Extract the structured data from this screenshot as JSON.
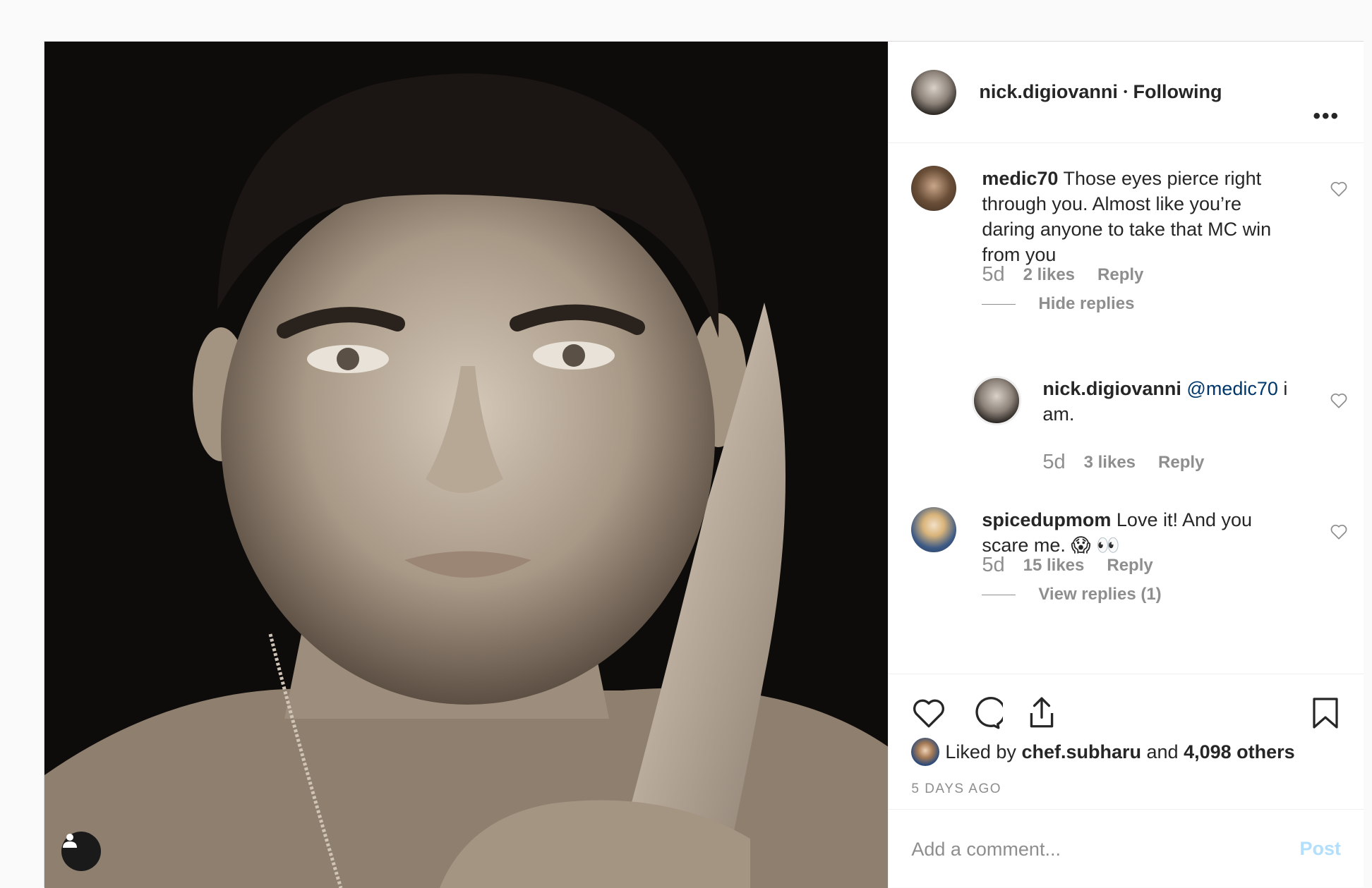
{
  "post": {
    "author": "nick.digiovanni",
    "separator": "•",
    "follow_status": "Following",
    "more_label": "•••"
  },
  "comments": [
    {
      "username": "medic70",
      "text": "Those eyes pierce right through you. Almost like you’re daring anyone to take that MC win from you",
      "time": "5d",
      "likes": "2 likes",
      "reply_label": "Reply",
      "toggle_label": "Hide replies",
      "replies": [
        {
          "username": "nick.digiovanni",
          "mention": "@medic70",
          "text": "i am.",
          "time": "5d",
          "likes": "3 likes",
          "reply_label": "Reply"
        }
      ]
    },
    {
      "username": "spicedupmom",
      "text": "Love it! And you scare me. 😱 👀",
      "time": "5d",
      "likes": "15 likes",
      "reply_label": "Reply",
      "toggle_label": "View replies (1)"
    }
  ],
  "likes_summary": {
    "prefix": "Liked by",
    "user": "chef.subharu",
    "conj": "and",
    "others": "4,098 others"
  },
  "posted_ago": "5 DAYS AGO",
  "comment_box": {
    "placeholder": "Add a comment...",
    "post_label": "Post"
  },
  "icons": {
    "like": "heart-icon",
    "comment": "comment-bubble-icon",
    "share": "share-icon",
    "save": "bookmark-icon",
    "tag": "user-tag-icon",
    "more": "more-options-icon"
  },
  "colors": {
    "post_button_disabled": "#b2dffc",
    "mention": "#00376b",
    "muted": "#8e8e8e"
  }
}
